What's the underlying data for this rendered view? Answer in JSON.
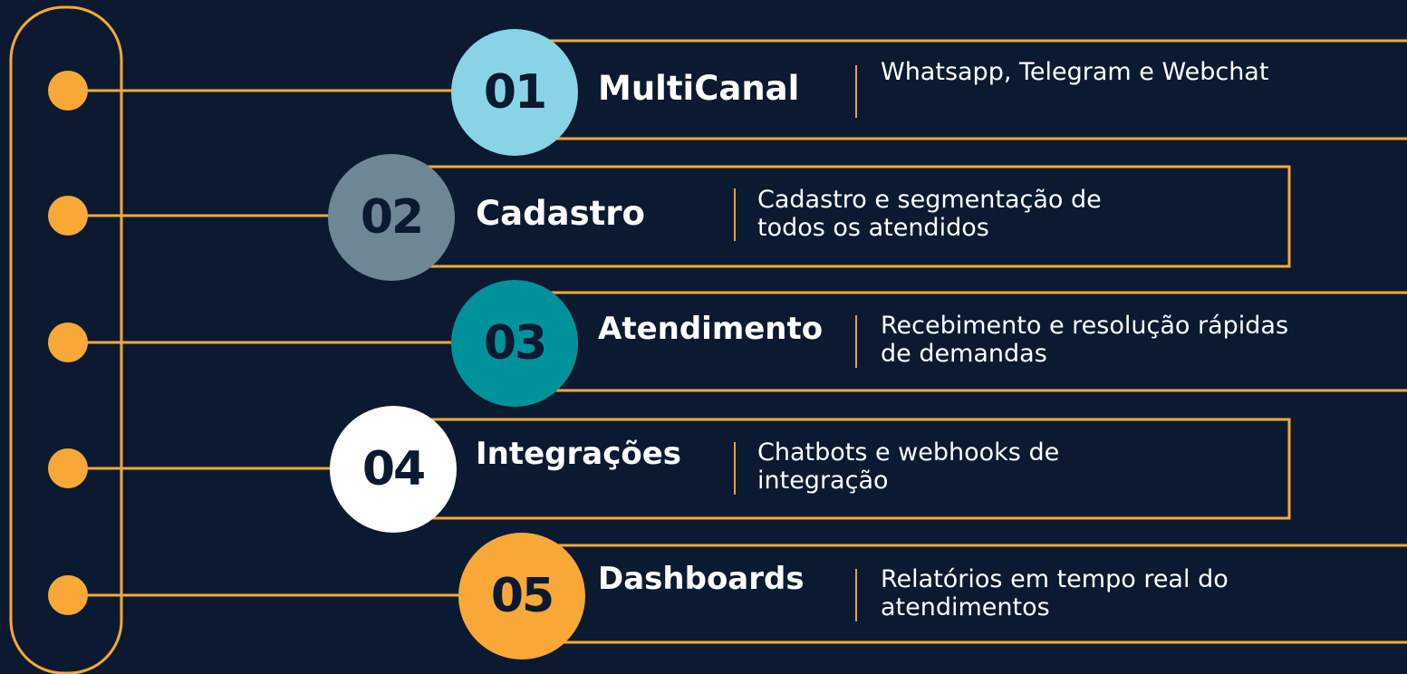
{
  "colors": {
    "background": "#0b1a30",
    "accent": "#f7a837",
    "circle_01": "#89d3e6",
    "circle_02": "#6f8794",
    "circle_03": "#00929b",
    "circle_04": "#ffffff",
    "circle_05": "#f7a837"
  },
  "items": [
    {
      "number": "01",
      "title": "MultiCanal",
      "description": "Whatsapp, Telegram e Webchat"
    },
    {
      "number": "02",
      "title": "Cadastro",
      "description": "Cadastro e segmentação de todos os atendidos"
    },
    {
      "number": "03",
      "title": "Atendimento",
      "description": "Recebimento e resolução rápidas de demandas"
    },
    {
      "number": "04",
      "title": "Integrações",
      "description": "Chatbots e webhooks de integração"
    },
    {
      "number": "05",
      "title": "Dashboards",
      "description": "Relatórios em tempo real do atendimentos"
    }
  ]
}
